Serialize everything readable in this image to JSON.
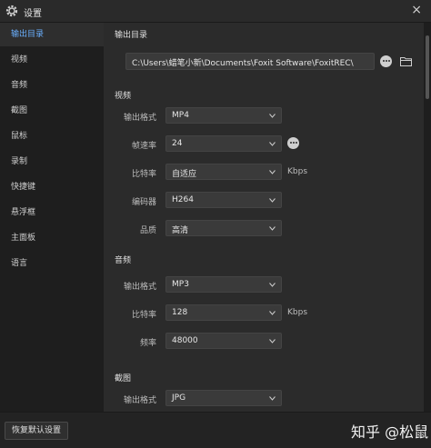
{
  "window": {
    "title": "设置",
    "close_glyph": "×"
  },
  "sidebar": {
    "items": [
      {
        "label": "输出目录",
        "active": true
      },
      {
        "label": "视频"
      },
      {
        "label": "音频"
      },
      {
        "label": "截图"
      },
      {
        "label": "鼠标"
      },
      {
        "label": "录制"
      },
      {
        "label": "快捷键"
      },
      {
        "label": "悬浮框"
      },
      {
        "label": "主面板"
      },
      {
        "label": "语言"
      }
    ]
  },
  "output": {
    "section_title": "输出目录",
    "path": "C:\\Users\\蜡笔小新\\Documents\\Foxit Software\\FoxitREC\\"
  },
  "video": {
    "section_title": "视频",
    "format_label": "输出格式",
    "format_value": "MP4",
    "fps_label": "帧速率",
    "fps_value": "24",
    "bitrate_label": "比特率",
    "bitrate_value": "自适应",
    "bitrate_unit": "Kbps",
    "encoder_label": "编码器",
    "encoder_value": "H264",
    "quality_label": "品质",
    "quality_value": "高清"
  },
  "audio": {
    "section_title": "音频",
    "format_label": "输出格式",
    "format_value": "MP3",
    "bitrate_label": "比特率",
    "bitrate_value": "128",
    "bitrate_unit": "Kbps",
    "freq_label": "频率",
    "freq_value": "48000"
  },
  "screenshot": {
    "section_title": "截图",
    "format_label": "输出格式",
    "format_value": "JPG"
  },
  "footer": {
    "reset_label": "恢复默认设置",
    "watermark": "知乎 @松鼠"
  },
  "colors": {
    "accent": "#6ab0ff",
    "background": "#2b2b2b",
    "sidebar": "#1e1e1e"
  },
  "icons": {
    "title": "gear-icon",
    "more": "more-dots-icon",
    "folder": "folder-icon",
    "dropdown": "chevron-down-icon"
  }
}
